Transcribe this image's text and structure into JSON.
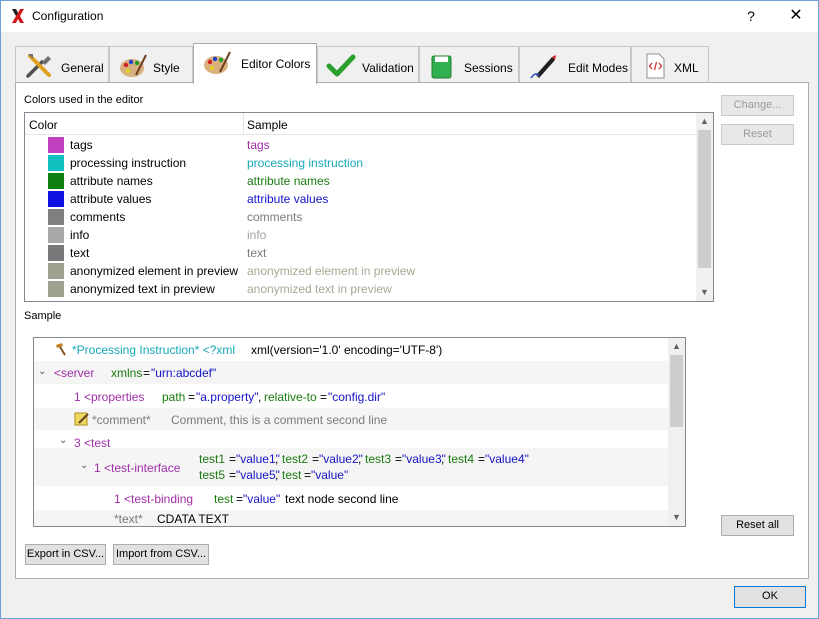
{
  "window": {
    "title": "Configuration",
    "help": "?",
    "close": "✕"
  },
  "tabs": [
    {
      "label": "General",
      "icon": "tools-icon"
    },
    {
      "label": "Style",
      "icon": "palette-icon"
    },
    {
      "label": "Editor Colors",
      "icon": "palette-icon",
      "active": true
    },
    {
      "label": "Validation",
      "icon": "checkmark-icon"
    },
    {
      "label": "Sessions",
      "icon": "sessions-icon"
    },
    {
      "label": "Edit Modes",
      "icon": "pen-icon"
    },
    {
      "label": "XML",
      "icon": "xml-file-icon"
    }
  ],
  "colors_section": {
    "label": "Colors used in the editor",
    "col_color": "Color",
    "col_sample": "Sample",
    "rows": [
      {
        "name": "tags",
        "sample": "tags",
        "color": "#c040c0",
        "sample_color": "#a02ea8"
      },
      {
        "name": "processing instruction",
        "sample": "processing instruction",
        "color": "#10c0c0",
        "sample_color": "#16a8b8"
      },
      {
        "name": "attribute names",
        "sample": "attribute names",
        "color": "#108010",
        "sample_color": "#1a7a10"
      },
      {
        "name": "attribute values",
        "sample": "attribute values",
        "color": "#1010e0",
        "sample_color": "#1414c8"
      },
      {
        "name": "comments",
        "sample": "comments",
        "color": "#808080",
        "sample_color": "#7a7a7a"
      },
      {
        "name": "info",
        "sample": "info",
        "color": "#a8a8a8",
        "sample_color": "#a0a0a0"
      },
      {
        "name": "text",
        "sample": "text",
        "color": "#787878",
        "sample_color": "#7a7a7a"
      },
      {
        "name": "anonymized element in preview",
        "sample": "anonymized element in preview",
        "color": "#a0a090",
        "sample_color": "#a8a896"
      },
      {
        "name": "anonymized text in preview",
        "sample": "anonymized text in preview",
        "color": "#a0a090",
        "sample_color": "#a8a896"
      }
    ]
  },
  "buttons": {
    "change": "Change...",
    "reset": "Reset",
    "reset_all": "Reset all",
    "export_csv": "Export in CSV...",
    "import_csv": "Import from CSV...",
    "ok": "OK"
  },
  "sample_section": {
    "label": "Sample",
    "pi": {
      "label": "*Processing Instruction* <?xml",
      "text": "xml(version='1.0' encoding='UTF-8')"
    },
    "server": {
      "toggle": "⌄",
      "tag": "<server",
      "attr": "xmlns",
      "eq": "=",
      "val": "\"urn:abcdef\""
    },
    "properties": {
      "count": "1",
      "tag": "<properties",
      "attr1": "path",
      "val1": "\"a.property\"",
      "sep": ", ",
      "attr2": "relative-to",
      "val2": "\"config.dir\""
    },
    "comment": {
      "label": "*comment*",
      "text": "Comment, this is a comment second line"
    },
    "test": {
      "toggle": "⌄",
      "count": "3",
      "tag": "<test"
    },
    "test_interface": {
      "toggle": "⌄",
      "count": "1",
      "tag": "<test-interface",
      "a1": "test1",
      "v1": "\"value1\"",
      "a2": "test2",
      "v2": "\"value2\"",
      "a3": "test3",
      "v3": "\"value3\"",
      "a4": "test4",
      "v4": "\"value4\"",
      "a5": "test5",
      "v5": "\"value5\"",
      "a6": "test",
      "v6": "\"value\""
    },
    "test_binding": {
      "count": "1",
      "tag": "<test-binding",
      "attr": "test",
      "val": "\"value\"",
      "text": "text node second line"
    },
    "cdata": {
      "label": "*text*",
      "text": "CDATA TEXT"
    }
  }
}
